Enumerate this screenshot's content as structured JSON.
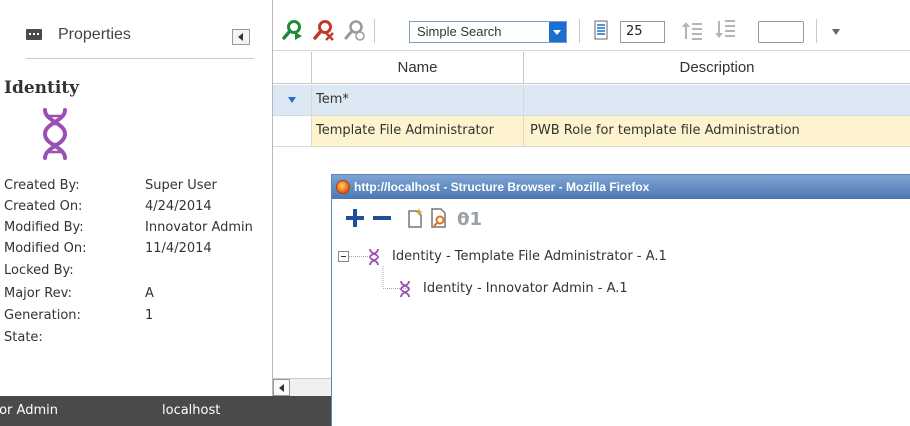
{
  "properties_panel": {
    "title": "Properties",
    "item_type": "Identity",
    "rows": [
      {
        "label": "Created By:",
        "value": "Super User"
      },
      {
        "label": "Created On:",
        "value": "4/24/2014"
      },
      {
        "label": "Modified By:",
        "value": "Innovator Admin"
      },
      {
        "label": "Modified On:",
        "value": "11/4/2014"
      },
      {
        "label": "Locked By:",
        "value": ""
      },
      {
        "label": "Major Rev:",
        "value": "A"
      },
      {
        "label": "Generation:",
        "value": "1"
      },
      {
        "label": "State:",
        "value": ""
      }
    ]
  },
  "toolbar": {
    "search_mode": "Simple Search",
    "page_size": "25",
    "icons": [
      "run-search-icon",
      "clear-search-icon",
      "saved-search-icon",
      "page-size-icon",
      "previous-page-icon",
      "next-page-icon",
      "more-dropdown-icon"
    ]
  },
  "grid": {
    "columns": [
      "Name",
      "Description"
    ],
    "filter": {
      "name": "Tem*",
      "description": ""
    },
    "rows": [
      {
        "name": "Template File Administrator",
        "description": "PWB Role for template file Administration"
      }
    ]
  },
  "statusbar": {
    "user": "tor Admin",
    "server": "localhost"
  },
  "popup": {
    "title": "http://localhost - Structure Browser - Mozilla Firefox",
    "toolbar_icons": [
      "add-icon",
      "remove-icon",
      "new-item-icon",
      "search-item-icon",
      "numbering-icon"
    ],
    "tree": [
      {
        "label": "Identity - Template File Administrator - A.1",
        "level": 0,
        "expanded": true
      },
      {
        "label": "Identity - Innovator Admin - A.1",
        "level": 1,
        "expanded": false
      }
    ]
  },
  "colors": {
    "accent": "#1b6fcf",
    "filter_row": "#dde8f5",
    "selected_row": "#fdf3cf",
    "statusbar": "#4a4a4a",
    "identity_icon": "#9a4fb5",
    "search_icon_green": "#1f8a3a",
    "search_icon_red": "#c0392b"
  }
}
